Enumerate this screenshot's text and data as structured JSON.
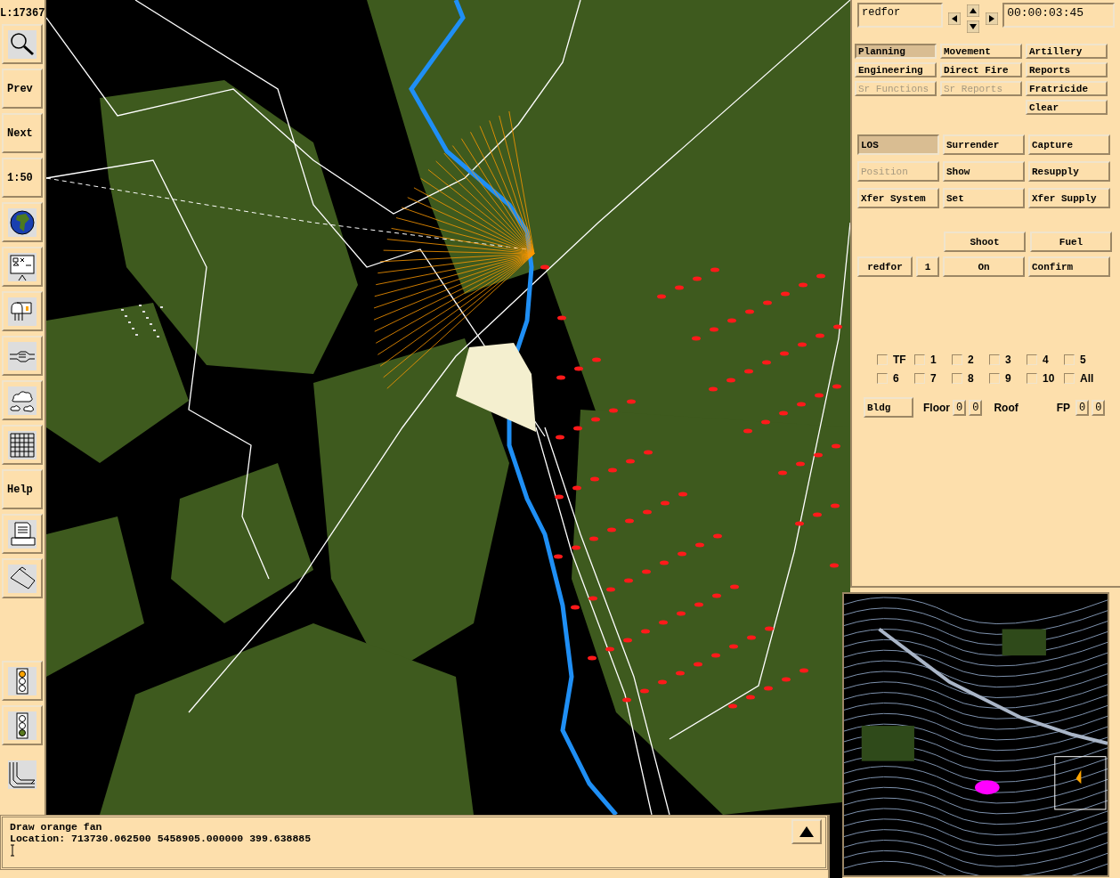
{
  "toolbar": {
    "scale_readout": "L:17367",
    "text_tools": [
      "Prev",
      "Next",
      "1:50"
    ],
    "help": "Help"
  },
  "control_panel": {
    "side": "redfor",
    "time": "00:00:03:45",
    "function_buttons": [
      {
        "label": "Planning",
        "selected": true,
        "disabled": false
      },
      {
        "label": "Movement",
        "selected": false,
        "disabled": false
      },
      {
        "label": "Artillery",
        "selected": false,
        "disabled": false
      },
      {
        "label": "Engineering",
        "selected": false,
        "disabled": false
      },
      {
        "label": "Direct Fire",
        "selected": false,
        "disabled": false
      },
      {
        "label": "Reports",
        "selected": false,
        "disabled": false
      },
      {
        "label": "Sr Functions",
        "selected": false,
        "disabled": true
      },
      {
        "label": "Sr Reports",
        "selected": false,
        "disabled": true
      },
      {
        "label": "Fratricide",
        "selected": false,
        "disabled": false
      }
    ],
    "clear": "Clear",
    "action_buttons": [
      {
        "label": "LOS",
        "selected": true,
        "disabled": false
      },
      {
        "label": "Surrender",
        "selected": false,
        "disabled": false
      },
      {
        "label": "Capture",
        "selected": false,
        "disabled": false
      },
      {
        "label": "Position",
        "selected": false,
        "disabled": true
      },
      {
        "label": "Show",
        "selected": false,
        "disabled": false
      },
      {
        "label": "Resupply",
        "selected": false,
        "disabled": false
      },
      {
        "label": "Xfer System",
        "selected": false,
        "disabled": false
      },
      {
        "label": "Set",
        "selected": false,
        "disabled": false
      },
      {
        "label": "Xfer Supply",
        "selected": false,
        "disabled": false
      }
    ],
    "shoot": "Shoot",
    "fuel": "Fuel",
    "force": "redfor",
    "force_number": "1",
    "toggle": "On",
    "confirm": "Confirm",
    "filters": [
      {
        "label": "TF",
        "checked": false
      },
      {
        "label": "1",
        "checked": false
      },
      {
        "label": "2",
        "checked": false
      },
      {
        "label": "3",
        "checked": false
      },
      {
        "label": "4",
        "checked": false
      },
      {
        "label": "5",
        "checked": false
      },
      {
        "label": "6",
        "checked": false
      },
      {
        "label": "7",
        "checked": false
      },
      {
        "label": "8",
        "checked": false
      },
      {
        "label": "9",
        "checked": false
      },
      {
        "label": "10",
        "checked": false
      },
      {
        "label": "All",
        "checked": false
      }
    ],
    "building": {
      "button": "Bldg",
      "floor_label": "Floor",
      "floor_values": [
        "0",
        "0"
      ],
      "roof_label": "Roof",
      "fp_label": "FP",
      "fp_values": [
        "0",
        "0"
      ]
    }
  },
  "console": {
    "lines": [
      "Draw orange fan",
      "Location: 713730.062500 5458905.000000 399.638885"
    ]
  }
}
